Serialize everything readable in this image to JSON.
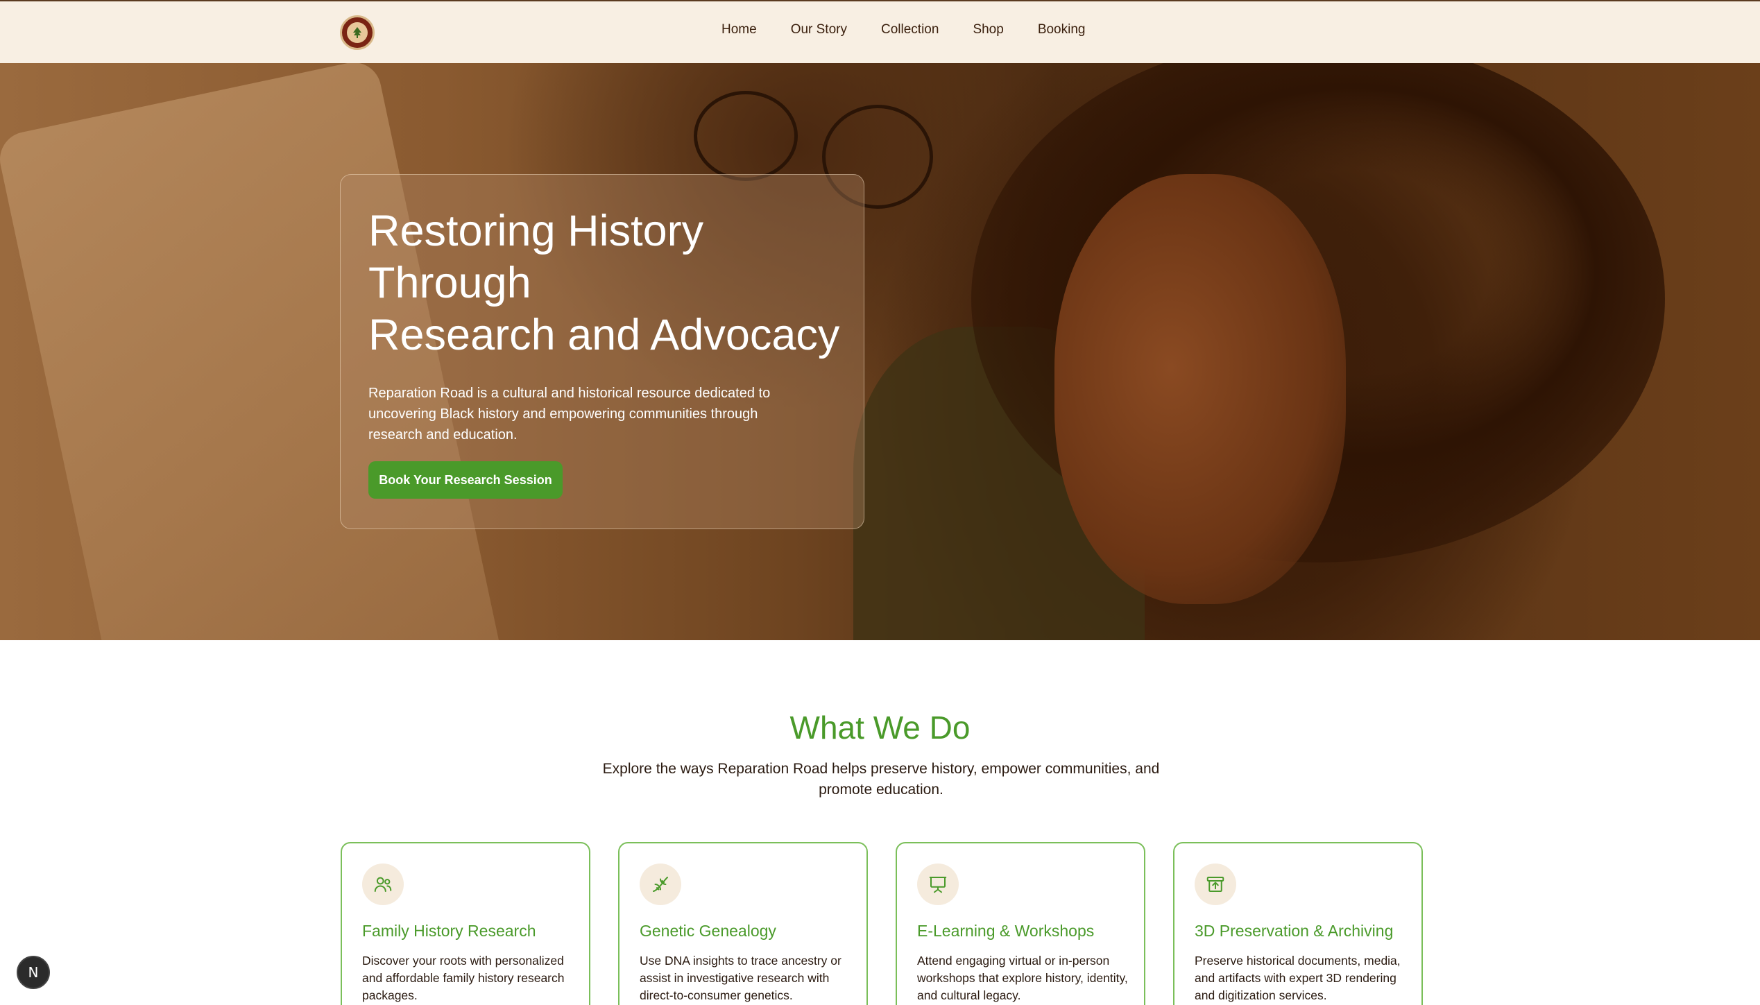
{
  "nav": {
    "links": [
      "Home",
      "Our Story",
      "Collection",
      "Shop",
      "Booking"
    ]
  },
  "hero": {
    "title_lines": [
      "Restoring History",
      "Through",
      "Research and Advocacy"
    ],
    "description": "Reparation Road is a cultural and historical resource dedicated to uncovering Black history and empowering communities through research and education.",
    "cta_label": "Book Your Research Session"
  },
  "what_we_do": {
    "title": "What We Do",
    "subtitle": "Explore the ways Reparation Road helps preserve history, empower communities, and promote education.",
    "cards": [
      {
        "icon": "users-icon",
        "title": "Family History Research",
        "description": "Discover your roots with personalized and affordable family history research packages."
      },
      {
        "icon": "dna-icon",
        "title": "Genetic Genealogy",
        "description": "Use DNA insights to trace ancestry or assist in investigative research with direct-to-consumer genetics."
      },
      {
        "icon": "presentation-icon",
        "title": "E-Learning & Workshops",
        "description": "Attend engaging virtual or in-person workshops that explore history, identity, and cultural legacy."
      },
      {
        "icon": "archive-icon",
        "title": "3D Preservation & Archiving",
        "description": "Preserve historical documents, media, and artifacts with expert 3D rendering and digitization services."
      }
    ]
  },
  "dev_badge": {
    "label": "N"
  },
  "colors": {
    "accent_green": "#4a9a2a",
    "nav_bg": "#f8efe3",
    "nav_text": "#3b200e",
    "card_border": "#7bbf5a"
  }
}
